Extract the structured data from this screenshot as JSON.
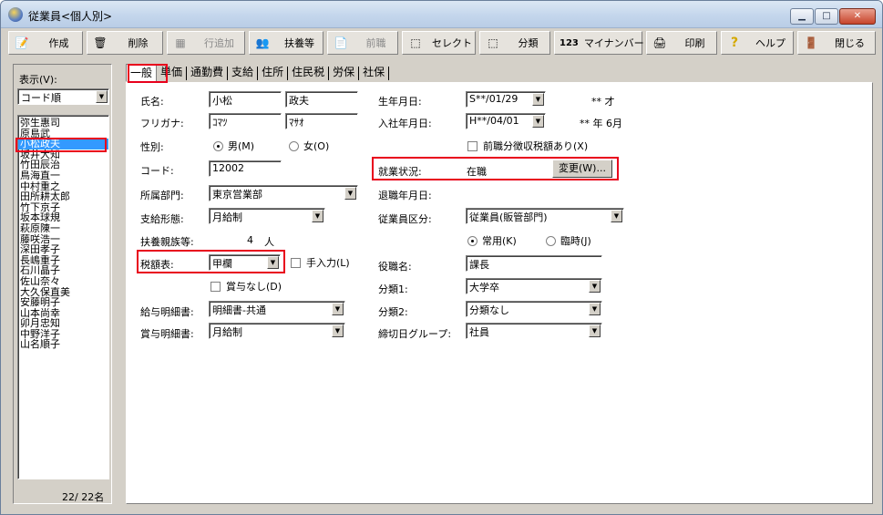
{
  "window": {
    "title": "従業員<個人別>"
  },
  "toolbar": {
    "create": "作成",
    "delete": "削除",
    "add_row": "行追加",
    "dependents": "扶養等",
    "previous_job": "前職",
    "select": "セレクト",
    "classify": "分類",
    "my_number": "マイナンバー",
    "print": "印刷",
    "help": "ヘルプ",
    "close": "閉じる"
  },
  "sidebar": {
    "display_label": "表示(V):",
    "sort_value": "コード順",
    "employees": [
      "弥生惠司",
      "原島武",
      "小松政夫",
      "坂井大知",
      "竹田辰治",
      "鳥海直一",
      "中村重之",
      "田所耕太郎",
      "竹下京子",
      "坂本球規",
      "萩原陳一",
      "藤咲浩一",
      "深田孝子",
      "長嶋重子",
      "石川晶子",
      "佐山奈々",
      "大久保直美",
      "安藤明子",
      "山本尚幸",
      "卯月忠知",
      "中野洋子",
      "山名順子"
    ],
    "selected_index": 2,
    "count": "22/ 22名"
  },
  "tabs": [
    "一般",
    "単価",
    "通勤費",
    "支給",
    "住所",
    "住民税",
    "労保",
    "社保"
  ],
  "form": {
    "name_label": "氏名:",
    "last_name": "小松",
    "first_name": "政夫",
    "kana_label": "フリガナ:",
    "last_kana": "ｺﾏﾂ",
    "first_kana": "ﾏｻｵ",
    "gender_label": "性別:",
    "gender_male": "男(M)",
    "gender_female": "女(O)",
    "code_label": "コード:",
    "code": "12002",
    "dept_label": "所属部門:",
    "dept": "東京営業部",
    "pay_type_label": "支給形態:",
    "pay_type": "月給制",
    "dependents_label": "扶養親族等:",
    "dependents_count": "4",
    "dependents_unit": "人",
    "tax_table_label": "税額表:",
    "tax_table": "甲欄",
    "manual_input": "手入力(L)",
    "no_bonus": "賞与なし(D)",
    "payslip_label": "給与明細書:",
    "payslip": "明細書-共通",
    "bonus_slip_label": "賞与明細書:",
    "bonus_slip": "月給制",
    "birth_label": "生年月日:",
    "birth": "S**/01/29",
    "age": "** 才",
    "hire_label": "入社年月日:",
    "hire": "H**/04/01",
    "tenure": "** 年 6月",
    "prev_tax": "前職分徴収税額あり(X)",
    "status_label": "就業状況:",
    "status": "在職",
    "change_button": "変更(W)...",
    "retire_label": "退職年月日:",
    "emp_class_label": "従業員区分:",
    "emp_class": "従業員(販管部門)",
    "regular": "常用(K)",
    "temporary": "臨時(J)",
    "title_label": "役職名:",
    "title": "課長",
    "class1_label": "分類1:",
    "class1": "大学卒",
    "class2_label": "分類2:",
    "class2": "分類なし",
    "cutoff_label": "締切日グループ:",
    "cutoff": "社員"
  }
}
